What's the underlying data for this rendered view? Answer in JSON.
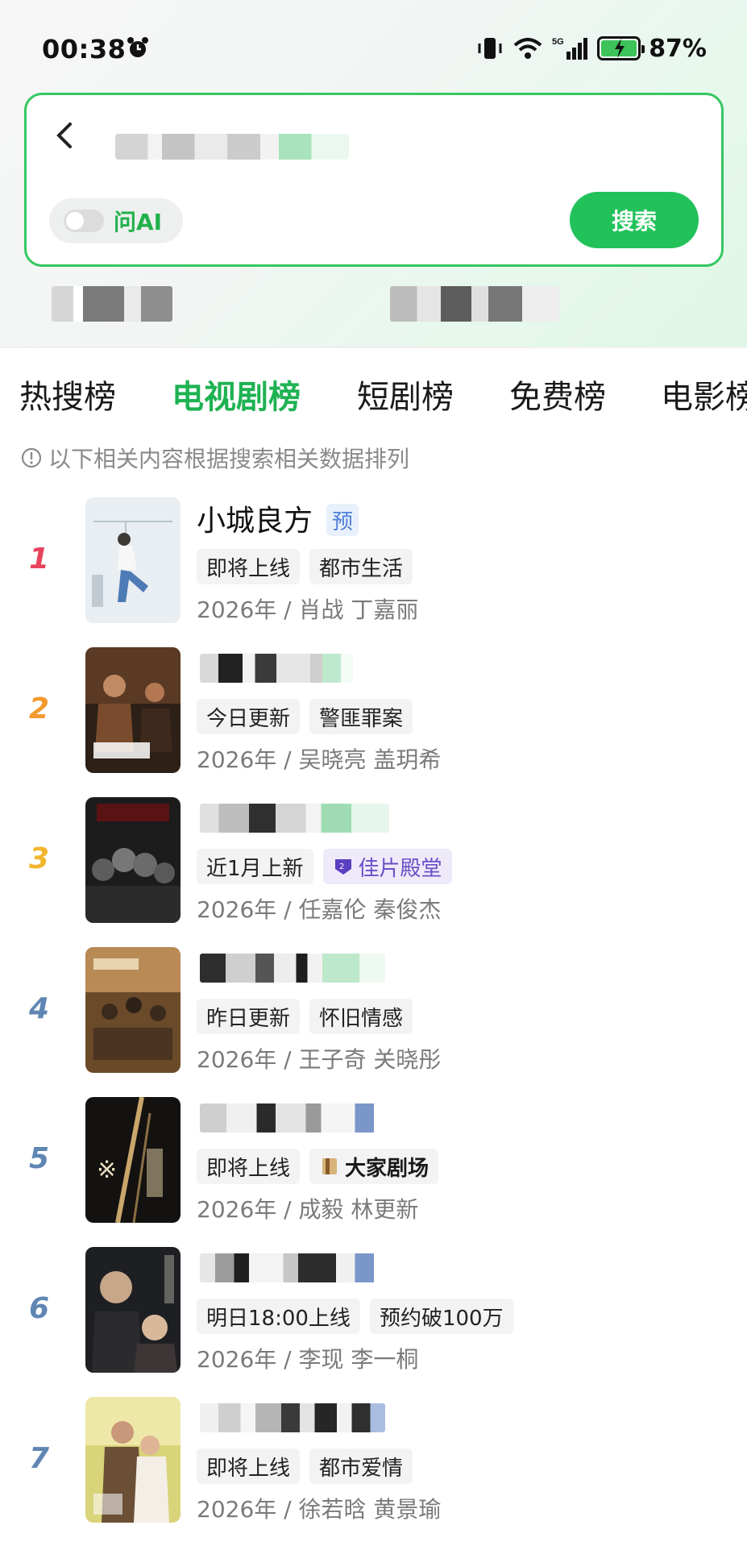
{
  "status_bar": {
    "time": "00:38",
    "battery_pct": "87%",
    "network": "5G",
    "alarm_icon": "alarm-clock-icon"
  },
  "search": {
    "ai_toggle_label": "问AI",
    "search_button": "搜索"
  },
  "tabs": [
    {
      "label": "热搜榜",
      "active": false
    },
    {
      "label": "电视剧榜",
      "active": true
    },
    {
      "label": "短剧榜",
      "active": false
    },
    {
      "label": "免费榜",
      "active": false
    },
    {
      "label": "电影榜",
      "active": false
    }
  ],
  "notice": "以下相关内容根据搜索相关数据排列",
  "colors": {
    "accent": "#21c25a",
    "rank1": "#e8455d",
    "rank2": "#f29a2e",
    "rank3": "#f2b62e",
    "rank_other": "#5f86b3"
  },
  "items": [
    {
      "rank": "1",
      "title": "小城良方",
      "badge": "预",
      "tags": [
        "即将上线",
        "都市生活"
      ],
      "meta": "2026年 / 肖战 丁嘉丽"
    },
    {
      "rank": "2",
      "tags": [
        "今日更新",
        "警匪罪案"
      ],
      "meta": "2026年 / 吴晓亮 盖玥希"
    },
    {
      "rank": "3",
      "tags": [
        "近1月上新",
        "佳片殿堂"
      ],
      "meta": "2026年 / 任嘉伦 秦俊杰"
    },
    {
      "rank": "4",
      "tags": [
        "昨日更新",
        "怀旧情感"
      ],
      "meta": "2026年 / 王子奇 关晓彤"
    },
    {
      "rank": "5",
      "tags": [
        "即将上线",
        "大家剧场"
      ],
      "meta": "2026年 / 成毅 林更新"
    },
    {
      "rank": "6",
      "tags": [
        "明日18:00上线",
        "预约破100万"
      ],
      "meta": "2026年 / 李现 李一桐"
    },
    {
      "rank": "7",
      "tags": [
        "即将上线",
        "都市爱情"
      ],
      "meta": "2026年 / 徐若晗 黄景瑜"
    }
  ]
}
